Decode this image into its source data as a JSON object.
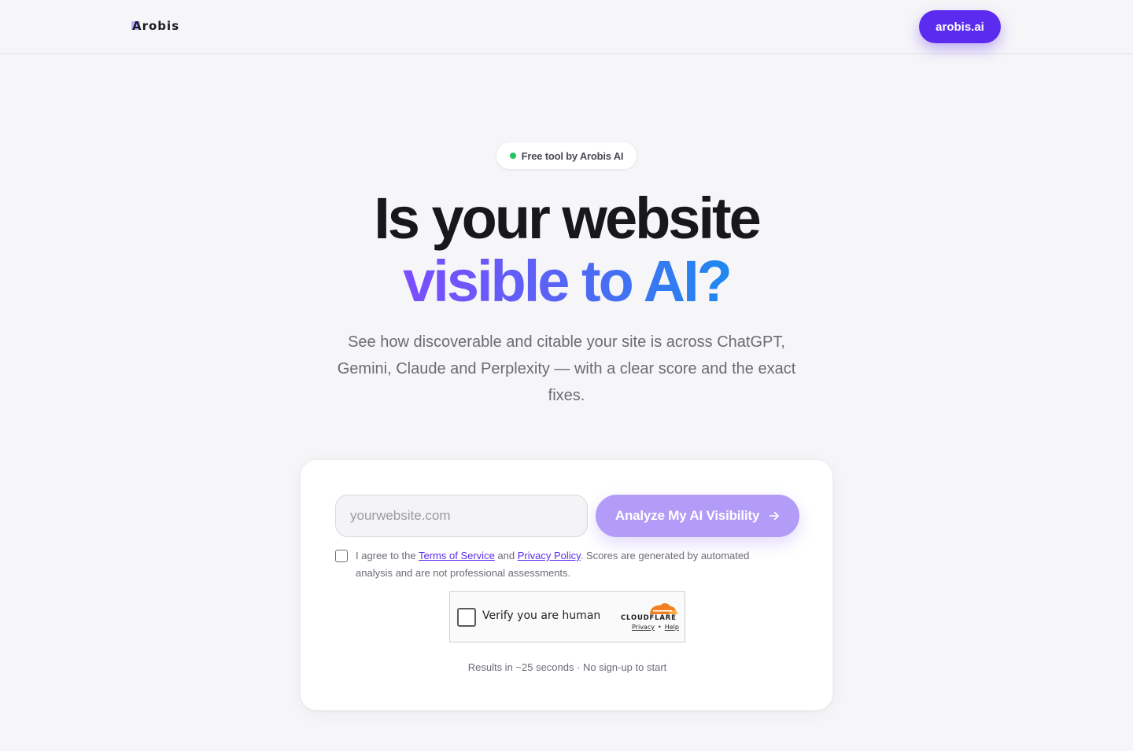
{
  "header": {
    "logo_text": "Arobis",
    "nav_button_label": "arobis.ai"
  },
  "hero": {
    "badge_text": "Free tool by Arobis AI",
    "headline_line1": "Is your website",
    "headline_line2": "visible to AI?",
    "subtitle": "See how discoverable and citable your site is across ChatGPT, Gemini, Claude and Perplexity — with a clear score and the exact fixes."
  },
  "form": {
    "url_placeholder": "yourwebsite.com",
    "url_value": "",
    "analyze_label": "Analyze My AI Visibility",
    "agree_prefix": "I agree to the ",
    "terms_link": "Terms of Service",
    "agree_and": " and ",
    "privacy_link": "Privacy Policy",
    "agree_suffix": ". Scores are generated by automated analysis and are not professional assessments.",
    "agree_checked": false,
    "footnote": "Results in ~25 seconds · No sign-up to start"
  },
  "captcha": {
    "label": "Verify you are human",
    "brand": "CLOUDFLARE",
    "privacy_link": "Privacy",
    "separator": "•",
    "help_link": "Help"
  },
  "colors": {
    "brand_purple": "#5b2cf0",
    "button_disabled": "#b39cf8",
    "status_dot": "#22c55e",
    "gradient_start": "#7c4dff",
    "gradient_end": "#1e88f0",
    "cloudflare_orange": "#f38020"
  },
  "icons": {
    "status_dot": "status-dot-icon",
    "arrow": "arrow-right-icon",
    "cloudflare": "cloudflare-cloud-icon"
  }
}
